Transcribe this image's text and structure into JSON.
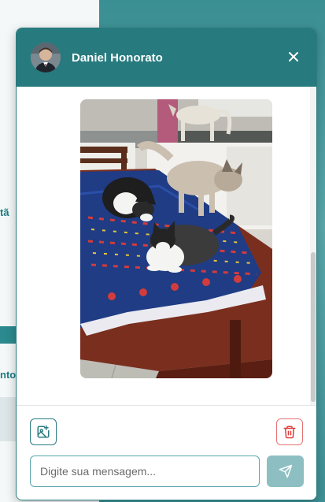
{
  "background": {
    "edge_texts": [
      "tã",
      "nto"
    ]
  },
  "chat": {
    "contact_name": "Daniel Honorato",
    "avatar_icon": "person-avatar",
    "close_icon": "close-icon",
    "message_image_alt": "Foto de gatos sobre a mesa",
    "composer": {
      "add_image_icon": "image-plus-icon",
      "delete_icon": "trash-icon",
      "input_placeholder": "Digite sua mensagem...",
      "input_value": "",
      "send_icon": "send-icon"
    }
  },
  "colors": {
    "header": "#277a7e",
    "accent": "#2a7b80",
    "danger": "#e57373",
    "send_disabled": "#8dbfc2"
  }
}
